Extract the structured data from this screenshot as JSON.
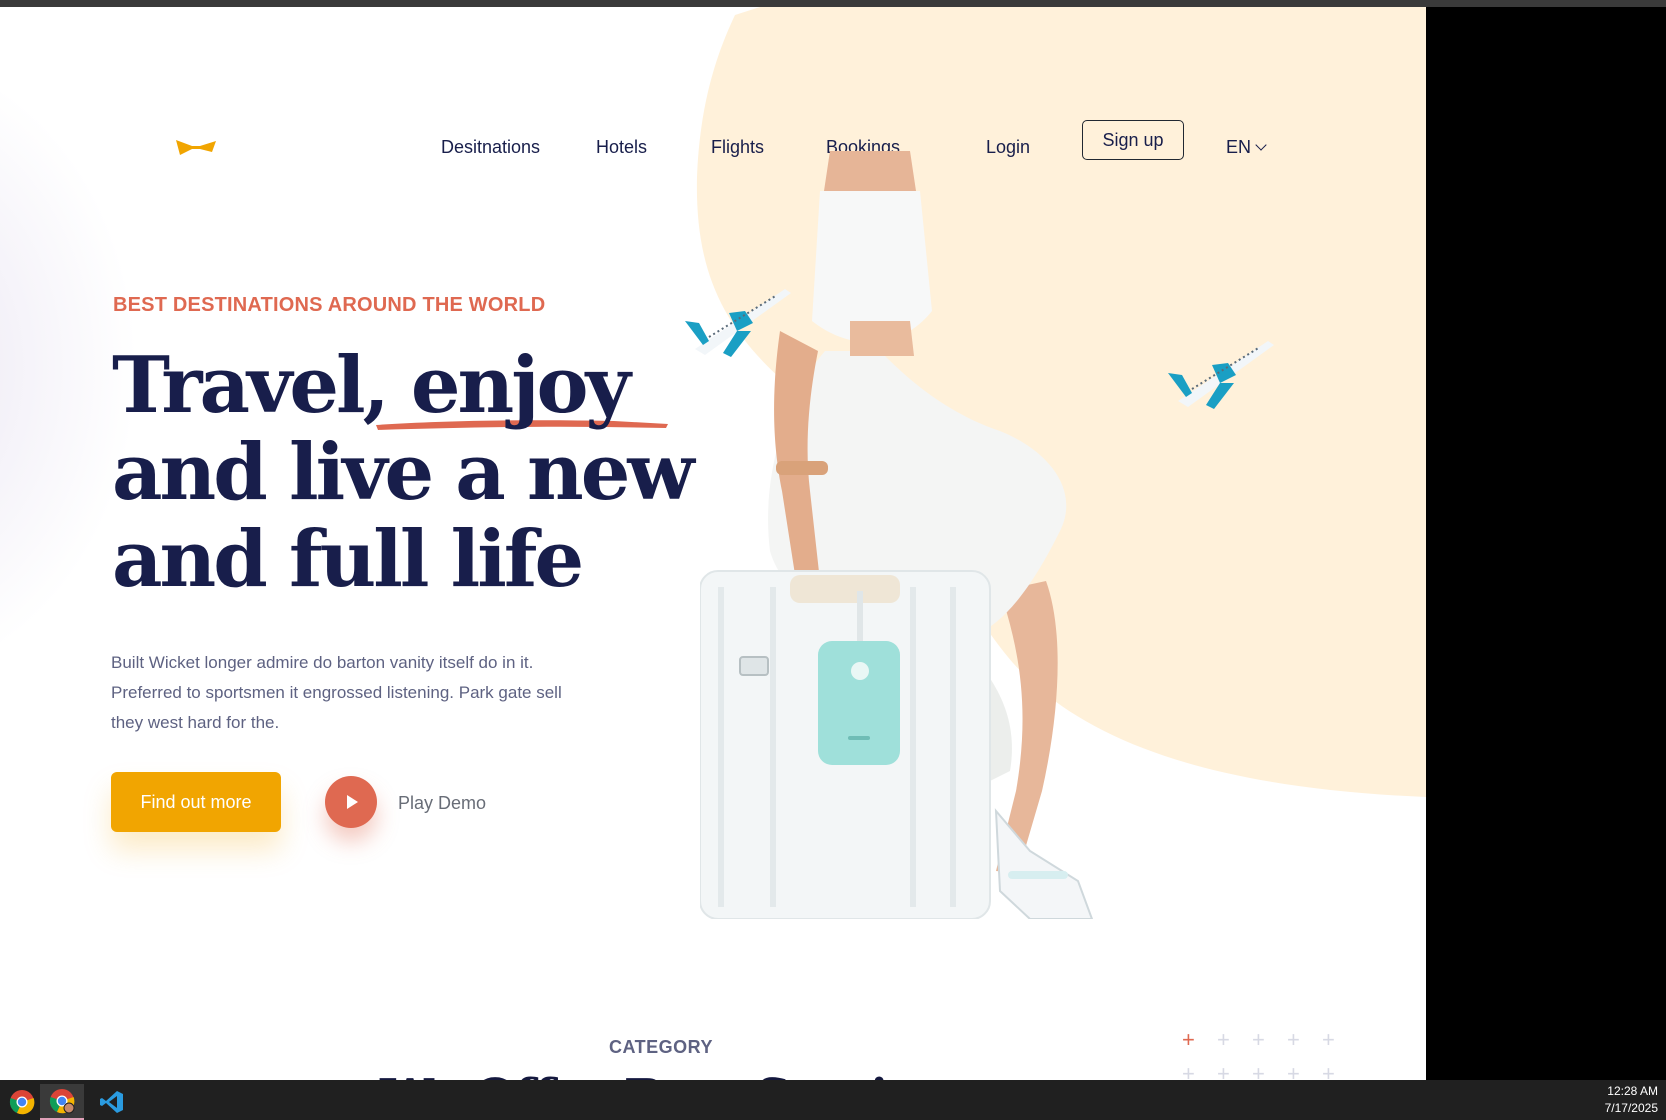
{
  "nav": {
    "links": [
      "Desitnations",
      "Hotels",
      "Flights",
      "Bookings",
      "Login"
    ],
    "signup": "Sign up",
    "language": "EN"
  },
  "hero": {
    "eyebrow": "BEST DESTINATIONS AROUND THE WORLD",
    "headline": [
      "Travel, enjoy",
      "and live a new",
      "and full life"
    ],
    "description": "Built Wicket longer admire do barton vanity itself do in it. Preferred to sportsmen it engrossed listening. Park gate sell they west hard for the.",
    "cta": "Find out more",
    "play_label": "Play Demo"
  },
  "category": {
    "eyebrow": "CATEGORY",
    "title": "We Offer Best Services"
  },
  "taskbar": {
    "time": "12:28 AM",
    "date": "7/17/2025",
    "apps": [
      "chrome-icon",
      "chrome-profile-icon",
      "vscode-icon"
    ]
  },
  "colors": {
    "accent_orange": "#df6951",
    "accent_yellow": "#f1a501",
    "navy": "#181e4b",
    "blob": "#fff1da"
  }
}
